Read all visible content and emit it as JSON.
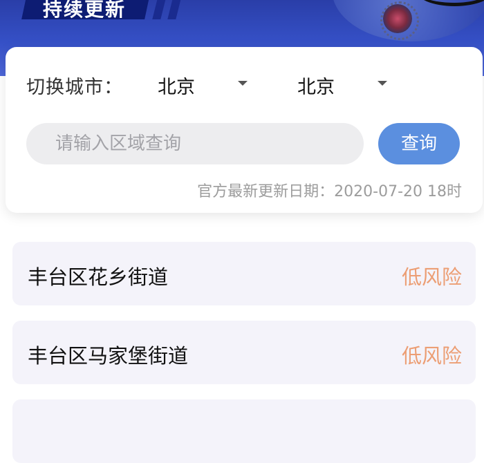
{
  "banner": {
    "title": "持续更新"
  },
  "query": {
    "city_label": "切换城市：",
    "province": "北京",
    "city": "北京",
    "search_placeholder": "请输入区域查询",
    "search_value": "",
    "search_button": "查询",
    "update_text": "官方最新更新日期：2020-07-20 18时"
  },
  "risk_list": [
    {
      "name": "丰台区花乡街道",
      "level": "低风险"
    },
    {
      "name": "丰台区马家堡街道",
      "level": "低风险"
    },
    {
      "name": "",
      "level": ""
    }
  ],
  "colors": {
    "banner": "#3550c6",
    "button": "#5b8fdf",
    "low_risk": "#ec9e74",
    "item_bg": "#f4f3fa"
  },
  "icons": {
    "province_caret": "chevron-down-icon",
    "city_caret": "chevron-down-icon"
  }
}
